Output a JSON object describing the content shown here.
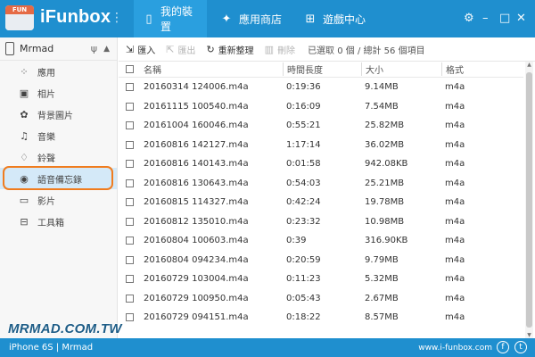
{
  "app": {
    "logo_text": "FUN",
    "name": "iFunbox",
    "menu_glyph": "⋮"
  },
  "tabs": [
    {
      "label": "我的裝置",
      "icon": "phone-icon"
    },
    {
      "label": "應用商店",
      "icon": "apps-icon"
    },
    {
      "label": "遊戲中心",
      "icon": "gamepad-icon"
    }
  ],
  "window": {
    "settings": "⚙",
    "minimize": "–",
    "maximize": "□",
    "close": "✕"
  },
  "device": {
    "name": "Mrmad"
  },
  "sidebar": {
    "items": [
      {
        "label": "應用",
        "icon": "apps-grid-icon"
      },
      {
        "label": "相片",
        "icon": "photo-icon"
      },
      {
        "label": "背景圖片",
        "icon": "wallpaper-icon"
      },
      {
        "label": "音樂",
        "icon": "music-icon"
      },
      {
        "label": "鈴聲",
        "icon": "bell-icon"
      },
      {
        "label": "語音備忘錄",
        "icon": "voice-memo-icon"
      },
      {
        "label": "影片",
        "icon": "video-icon"
      },
      {
        "label": "工具箱",
        "icon": "toolbox-icon"
      }
    ],
    "active_index": 5
  },
  "watermark": "MRMAD.COM.TW",
  "toolbar": {
    "import_label": "匯入",
    "export_label": "匯出",
    "refresh_label": "重新整理",
    "delete_label": "刪除",
    "status": "已選取 0 個 / 總計 56 個項目"
  },
  "table": {
    "columns": [
      "名稱",
      "時間長度",
      "大小",
      "格式"
    ],
    "rows": [
      [
        "20160314 124006.m4a",
        "0:19:36",
        "9.14MB",
        "m4a"
      ],
      [
        "20161115 100540.m4a",
        "0:16:09",
        "7.54MB",
        "m4a"
      ],
      [
        "20161004 160046.m4a",
        "0:55:21",
        "25.82MB",
        "m4a"
      ],
      [
        "20160816 142127.m4a",
        "1:17:14",
        "36.02MB",
        "m4a"
      ],
      [
        "20160816 140143.m4a",
        "0:01:58",
        "942.08KB",
        "m4a"
      ],
      [
        "20160816 130643.m4a",
        "0:54:03",
        "25.21MB",
        "m4a"
      ],
      [
        "20160815 114327.m4a",
        "0:42:24",
        "19.78MB",
        "m4a"
      ],
      [
        "20160812 135010.m4a",
        "0:23:32",
        "10.98MB",
        "m4a"
      ],
      [
        "20160804 100603.m4a",
        "0:39",
        "316.90KB",
        "m4a"
      ],
      [
        "20160804 094234.m4a",
        "0:20:59",
        "9.79MB",
        "m4a"
      ],
      [
        "20160729 103004.m4a",
        "0:11:23",
        "5.32MB",
        "m4a"
      ],
      [
        "20160729 100950.m4a",
        "0:05:43",
        "2.67MB",
        "m4a"
      ],
      [
        "20160729 094151.m4a",
        "0:18:22",
        "8.57MB",
        "m4a"
      ]
    ]
  },
  "statusbar": {
    "device": "iPhone 6S | Mrmad",
    "url": "www.i-funbox.com"
  },
  "colors": {
    "brand_blue": "#1f8fcf",
    "active_tab": "#2a9fdf",
    "highlight_orange": "#f07c1e",
    "logo_orange": "#e56a45"
  }
}
